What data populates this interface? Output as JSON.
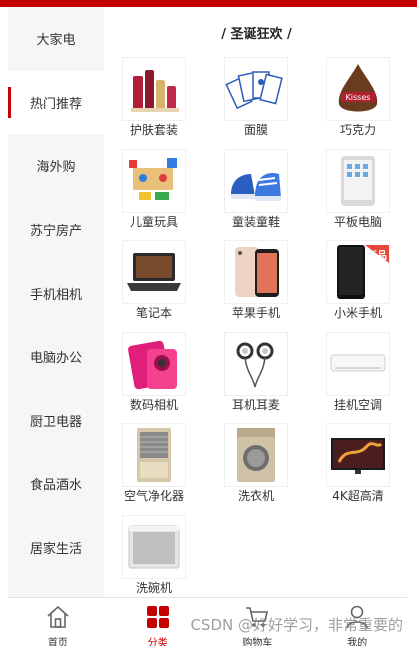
{
  "sidebar": {
    "items": [
      {
        "label": "大家电"
      },
      {
        "label": "热门推荐"
      },
      {
        "label": "海外购"
      },
      {
        "label": "苏宁房产"
      },
      {
        "label": "手机相机"
      },
      {
        "label": "电脑办公"
      },
      {
        "label": "厨卫电器"
      },
      {
        "label": "食品酒水"
      },
      {
        "label": "居家生活"
      }
    ],
    "active_index": 1
  },
  "section": {
    "title": "/ 圣诞狂欢 /"
  },
  "products": [
    {
      "label": "护肤套装",
      "icon": "skincare-set-icon"
    },
    {
      "label": "面膜",
      "icon": "face-mask-icon"
    },
    {
      "label": "巧克力",
      "icon": "chocolate-icon"
    },
    {
      "label": "儿童玩具",
      "icon": "kids-toy-icon"
    },
    {
      "label": "童装童鞋",
      "icon": "kids-shoes-icon"
    },
    {
      "label": "平板电脑",
      "icon": "tablet-icon"
    },
    {
      "label": "笔记本",
      "icon": "laptop-icon"
    },
    {
      "label": "苹果手机",
      "icon": "iphone-icon"
    },
    {
      "label": "小米手机",
      "icon": "xiaomi-phone-icon",
      "badge": "新品"
    },
    {
      "label": "数码相机",
      "icon": "digital-camera-icon"
    },
    {
      "label": "耳机耳麦",
      "icon": "earphones-icon"
    },
    {
      "label": "挂机空调",
      "icon": "air-conditioner-icon"
    },
    {
      "label": "空气净化器",
      "icon": "air-purifier-icon"
    },
    {
      "label": "洗衣机",
      "icon": "washing-machine-icon"
    },
    {
      "label": "4K超高清",
      "icon": "tv-4k-icon"
    },
    {
      "label": "洗碗机",
      "icon": "dishwasher-icon"
    }
  ],
  "tabbar": {
    "items": [
      {
        "label": "首页",
        "icon": "home-icon"
      },
      {
        "label": "分类",
        "icon": "category-icon"
      },
      {
        "label": "购物车",
        "icon": "cart-icon"
      },
      {
        "label": "我的",
        "icon": "user-icon"
      }
    ],
    "active_index": 1
  },
  "watermark": {
    "text": "CSDN @好好学习，非常重要的"
  },
  "colors": {
    "accent": "#c40000",
    "sidebar_bg": "#f6f6f6"
  }
}
